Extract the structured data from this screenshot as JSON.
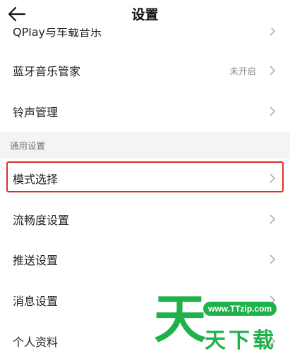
{
  "header": {
    "title": "设置",
    "back_icon": "arrow-left-icon"
  },
  "list": {
    "items": [
      {
        "label": "QPlay与车载音乐",
        "value": ""
      },
      {
        "label": "蓝牙音乐管家",
        "value": "未开启"
      },
      {
        "label": "铃声管理",
        "value": ""
      },
      {
        "label": "模式选择",
        "value": ""
      },
      {
        "label": "流畅度设置",
        "value": ""
      },
      {
        "label": "推送设置",
        "value": ""
      },
      {
        "label": "消息设置",
        "value": ""
      },
      {
        "label": "个人资料",
        "value": ""
      }
    ],
    "section_header": "通用设置"
  },
  "highlight": {
    "color": "#d9312a"
  },
  "watermark": {
    "url": "www.TTzip.com",
    "big": "天",
    "small": "天下载"
  },
  "colors": {
    "accent": "#1fb24a",
    "text": "#222222",
    "muted": "#888888",
    "divider_bg": "#f4f4f4"
  }
}
